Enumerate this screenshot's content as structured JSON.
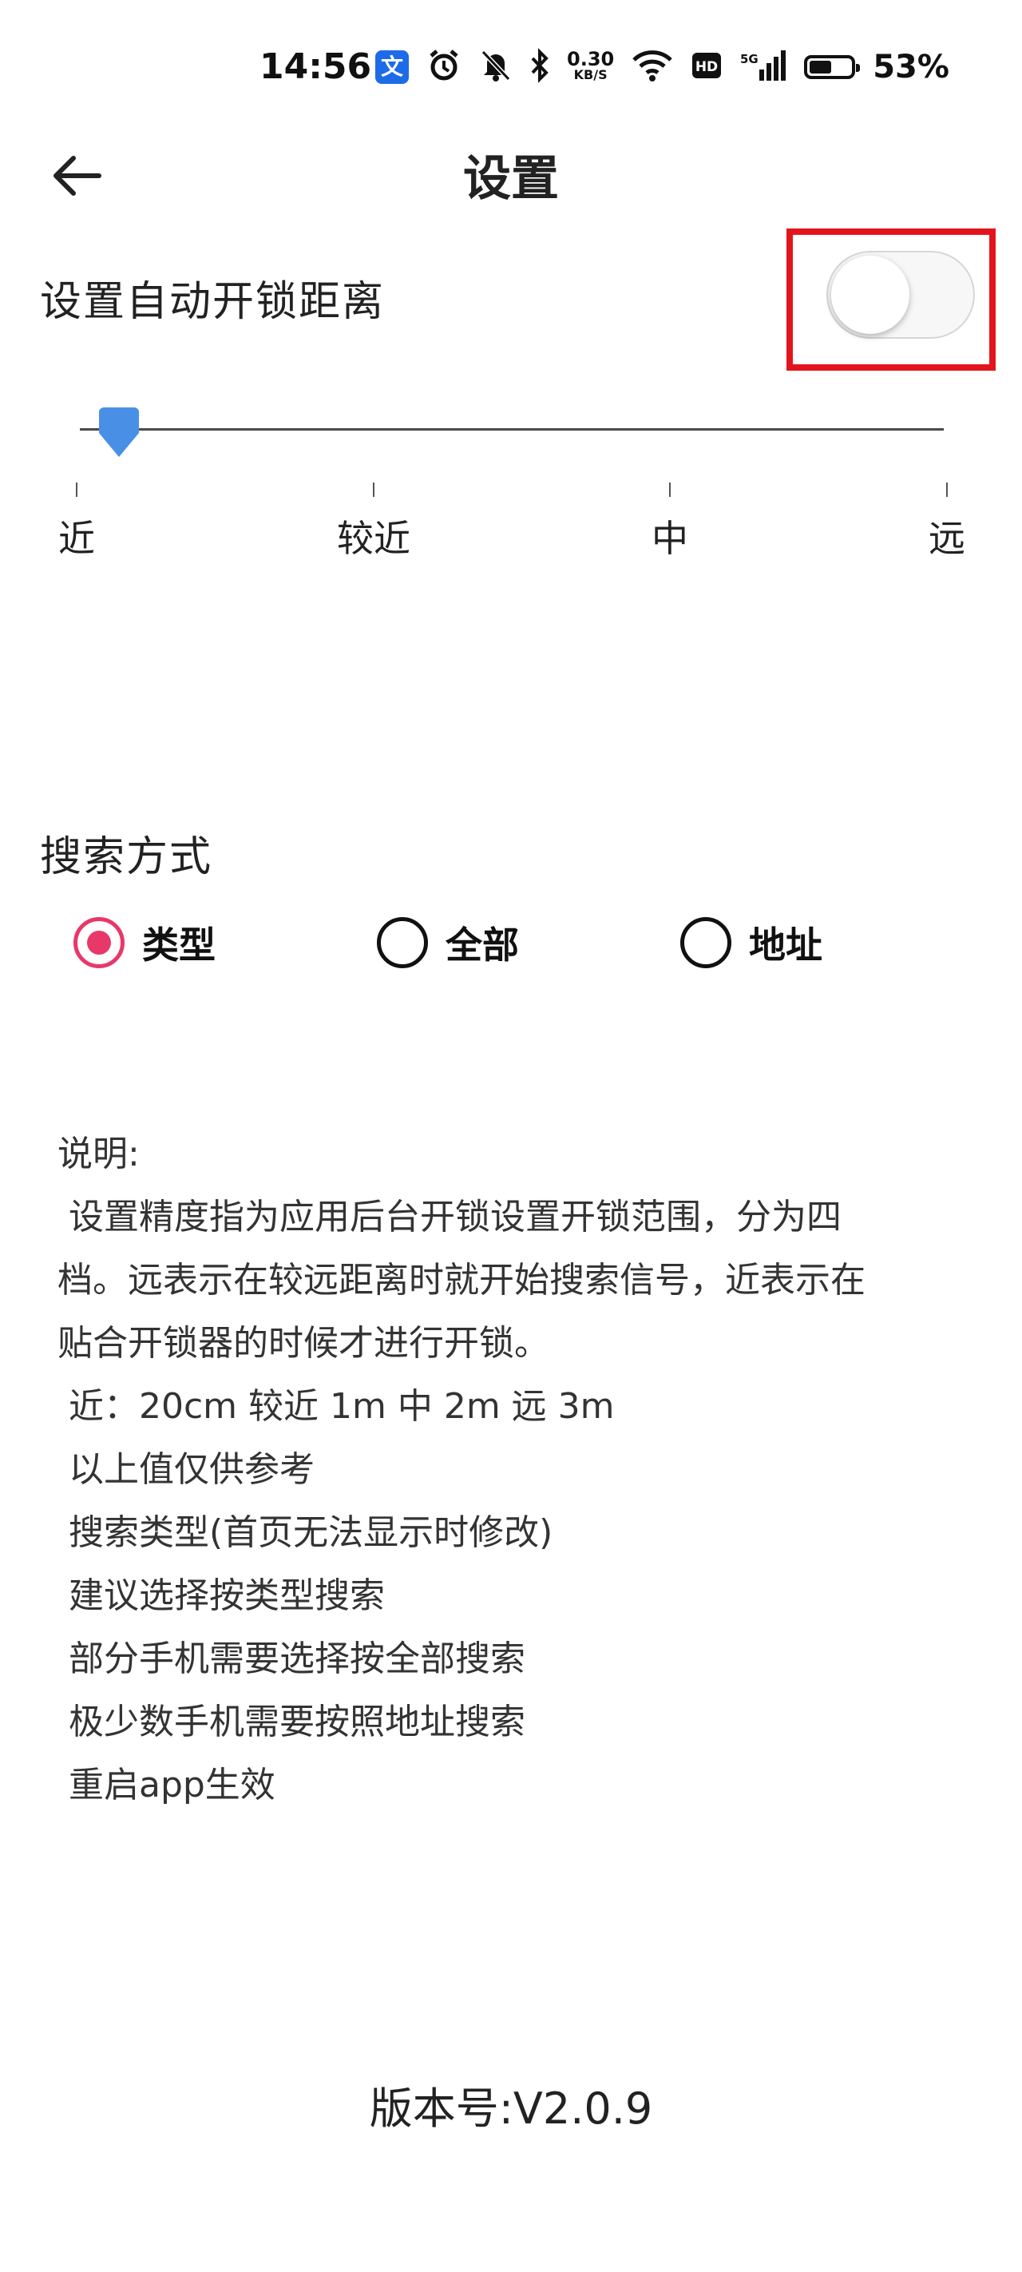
{
  "status_bar": {
    "time": "14:56",
    "app_badge": "文",
    "net_speed_top": "0.30",
    "net_speed_bottom": "KB/S",
    "network": "5G",
    "battery_percent": "53%",
    "battery_level": 0.53,
    "icons": [
      "alarm-icon",
      "mute-icon",
      "bluetooth-icon",
      "wifi-icon",
      "hd-icon",
      "signal-icon",
      "battery-icon"
    ]
  },
  "header": {
    "title": "设置",
    "back_icon": "arrow-left-icon"
  },
  "distance": {
    "label": "设置自动开锁距离",
    "toggle_on": false,
    "slider_level": 0,
    "ticks": [
      "近",
      "较近",
      "中",
      "远"
    ],
    "highlight_color": "#e3151c",
    "thumb_color": "#4a8fe6"
  },
  "search": {
    "label": "搜索方式",
    "options": [
      {
        "label": "类型",
        "selected": true
      },
      {
        "label": "全部",
        "selected": false
      },
      {
        "label": "地址",
        "selected": false
      }
    ],
    "accent_color": "#e8386a"
  },
  "description": {
    "lines": [
      "说明:",
      " 设置精度指为应用后台开锁设置开锁范围，分为四",
      "档。远表示在较远距离时就开始搜索信号，近表示在",
      "贴合开锁器的时候才进行开锁。",
      " 近：20cm 较近 1m 中 2m 远 3m",
      " 以上值仅供参考",
      " 搜索类型(首页无法显示时修改)",
      " 建议选择按类型搜索",
      " 部分手机需要选择按全部搜索",
      " 极少数手机需要按照地址搜索",
      " 重启app生效"
    ]
  },
  "version": "版本号:V2.0.9"
}
